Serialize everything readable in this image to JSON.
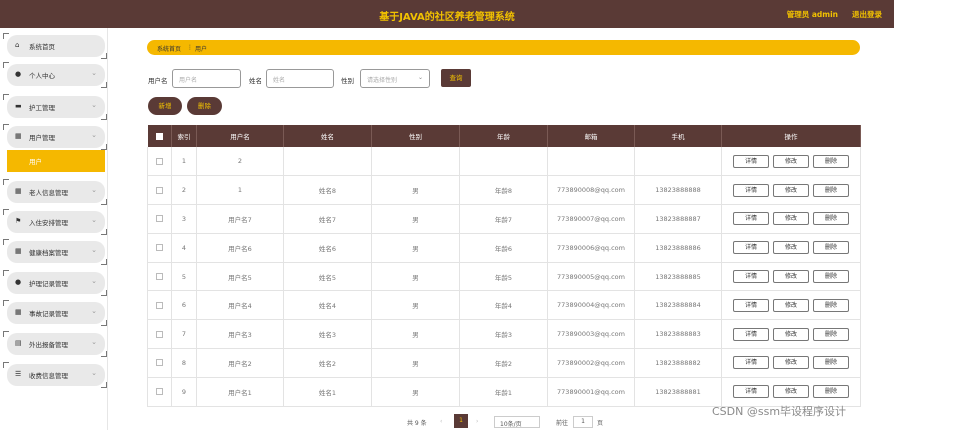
{
  "header": {
    "title": "基于JAVA的社区养老管理系统",
    "user": "管理员 admin",
    "logout": "退出登录"
  },
  "sidebar": {
    "items": [
      {
        "label": "系统首页",
        "icon": "home-icon",
        "glyph": "⌂"
      },
      {
        "label": "个人中心",
        "icon": "person-icon",
        "glyph": "●"
      },
      {
        "label": "护工管理",
        "icon": "briefcase-icon",
        "glyph": "▬"
      },
      {
        "label": "用户管理",
        "icon": "grid-icon",
        "glyph": "▦"
      },
      {
        "label": "老人信息管理",
        "icon": "grid-icon",
        "glyph": "▦"
      },
      {
        "label": "入住安排管理",
        "icon": "flag-icon",
        "glyph": "⚑"
      },
      {
        "label": "健康档案管理",
        "icon": "table-icon",
        "glyph": "▦"
      },
      {
        "label": "护理记录管理",
        "icon": "person-icon",
        "glyph": "●"
      },
      {
        "label": "事故记录管理",
        "icon": "grid-icon",
        "glyph": "▦"
      },
      {
        "label": "外出报备管理",
        "icon": "book-icon",
        "glyph": "▤"
      },
      {
        "label": "收费信息管理",
        "icon": "sliders-icon",
        "glyph": "☰"
      }
    ],
    "active_sub": "用户"
  },
  "breadcrumb": {
    "home": "系统首页",
    "sep": "⋮",
    "current": "用户"
  },
  "search": {
    "username_label": "用户名",
    "username_placeholder": "用户名",
    "name_label": "姓名",
    "name_placeholder": "姓名",
    "gender_label": "性别",
    "gender_placeholder": "请选择性别",
    "search_button": "查询"
  },
  "actions": {
    "add": "新增",
    "delete": "删除"
  },
  "table": {
    "headers": [
      "索引",
      "用户名",
      "姓名",
      "性别",
      "年龄",
      "邮箱",
      "手机",
      "操作"
    ],
    "rows": [
      {
        "index": "1",
        "username": "2",
        "name": "",
        "gender": "",
        "age": "",
        "email": "",
        "phone": ""
      },
      {
        "index": "2",
        "username": "1",
        "name": "姓名8",
        "gender": "男",
        "age": "年龄8",
        "email": "773890008@qq.com",
        "phone": "13823888888"
      },
      {
        "index": "3",
        "username": "用户名7",
        "name": "姓名7",
        "gender": "男",
        "age": "年龄7",
        "email": "773890007@qq.com",
        "phone": "13823888887"
      },
      {
        "index": "4",
        "username": "用户名6",
        "name": "姓名6",
        "gender": "男",
        "age": "年龄6",
        "email": "773890006@qq.com",
        "phone": "13823888886"
      },
      {
        "index": "5",
        "username": "用户名5",
        "name": "姓名5",
        "gender": "男",
        "age": "年龄5",
        "email": "773890005@qq.com",
        "phone": "13823888885"
      },
      {
        "index": "6",
        "username": "用户名4",
        "name": "姓名4",
        "gender": "男",
        "age": "年龄4",
        "email": "773890004@qq.com",
        "phone": "13823888884"
      },
      {
        "index": "7",
        "username": "用户名3",
        "name": "姓名3",
        "gender": "男",
        "age": "年龄3",
        "email": "773890003@qq.com",
        "phone": "13823888883"
      },
      {
        "index": "8",
        "username": "用户名2",
        "name": "姓名2",
        "gender": "男",
        "age": "年龄2",
        "email": "773890002@qq.com",
        "phone": "13823888882"
      },
      {
        "index": "9",
        "username": "用户名1",
        "name": "姓名1",
        "gender": "男",
        "age": "年龄1",
        "email": "773890001@qq.com",
        "phone": "13823888881"
      }
    ],
    "op_labels": {
      "detail": "详情",
      "edit": "修改",
      "delete": "删除"
    }
  },
  "pagination": {
    "total": "共 9 条",
    "prev": "‹",
    "page": "1",
    "next": "›",
    "size": "10条/页",
    "goto": "前往",
    "goto_value": "1",
    "page_unit": "页"
  },
  "watermark": "CSDN @ssm毕设程序设计"
}
